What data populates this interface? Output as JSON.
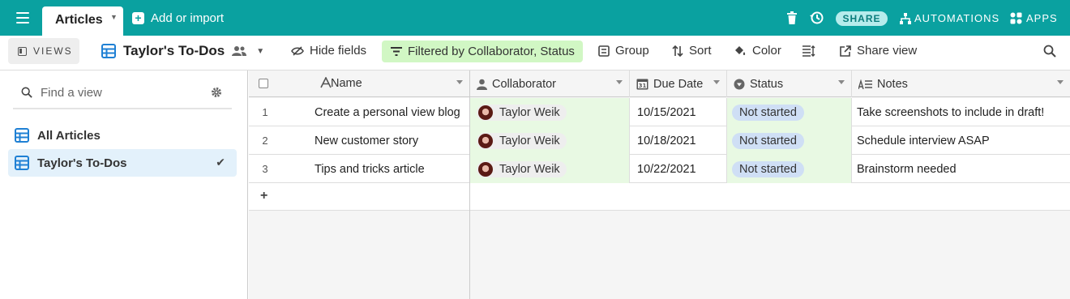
{
  "topbar": {
    "tab_label": "Articles",
    "add_import_label": "Add or import",
    "share_label": "SHARE",
    "automations_label": "AUTOMATIONS",
    "apps_label": "APPS",
    "color": "#0aa1a0"
  },
  "toolbar": {
    "views_label": "VIEWS",
    "view_title": "Taylor's To-Dos",
    "hide_fields": "Hide fields",
    "filter_label": "Filtered by Collaborator, Status",
    "group": "Group",
    "sort": "Sort",
    "color": "Color",
    "share_view": "Share view"
  },
  "sidebar": {
    "search_placeholder": "Find a view",
    "views": [
      {
        "label": "All Articles",
        "active": false
      },
      {
        "label": "Taylor's To-Dos",
        "active": true
      }
    ]
  },
  "grid": {
    "columns": [
      {
        "label": "Name",
        "icon": "text-icon"
      },
      {
        "label": "Collaborator",
        "icon": "user-icon"
      },
      {
        "label": "Due Date",
        "icon": "calendar-icon"
      },
      {
        "label": "Status",
        "icon": "dropdown-icon"
      },
      {
        "label": "Notes",
        "icon": "long-text-icon"
      }
    ],
    "calendar_day": "31",
    "rows": [
      {
        "num": "1",
        "name": "Create a personal view blog",
        "collaborator": "Taylor Weik",
        "due": "10/15/2021",
        "status": "Not started",
        "notes": "Take screenshots to include in draft!"
      },
      {
        "num": "2",
        "name": "New customer story",
        "collaborator": "Taylor Weik",
        "due": "10/18/2021",
        "status": "Not started",
        "notes": "Schedule interview ASAP"
      },
      {
        "num": "3",
        "name": "Tips and tricks article",
        "collaborator": "Taylor Weik",
        "due": "10/22/2021",
        "status": "Not started",
        "notes": "Brainstorm needed"
      }
    ],
    "add_row": "+"
  }
}
